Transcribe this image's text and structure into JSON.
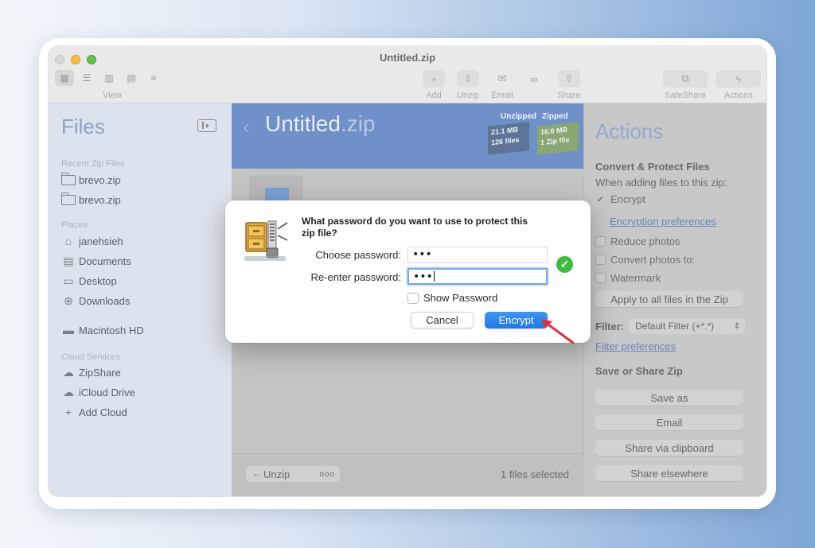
{
  "window": {
    "title": "Untitled.zip"
  },
  "toolbar": {
    "view_label": "View",
    "add_label": "Add",
    "unzip_label": "Unzip",
    "email_label": "Email",
    "link_label": "",
    "share_label": "Share",
    "safeshare_label": "SafeShare",
    "actions_label": "Actions"
  },
  "sidebar": {
    "title": "Files",
    "recent_header": "Recent Zip Files",
    "recent": [
      "brevo.zip",
      "brevo.zip"
    ],
    "places_header": "Places",
    "places": [
      "janehsieh",
      "Documents",
      "Desktop",
      "Downloads"
    ],
    "drive": "Macintosh HD",
    "cloud_header": "Cloud Services",
    "cloud": [
      "ZipShare",
      "iCloud Drive",
      "Add Cloud"
    ]
  },
  "main": {
    "zip_name": "Untitled",
    "zip_ext": ".zip",
    "unzipped_header": "Unzipped",
    "zipped_header": "Zipped",
    "unzipped_size": "21.1 MB",
    "unzipped_files": "126 files",
    "zipped_size": "16.0 MB",
    "zipped_files": "1 Zip file",
    "unzip_button": "Unzip",
    "more_button": "ooo",
    "selection_status": "1 files selected"
  },
  "actions": {
    "title": "Actions",
    "convert_header": "Convert & Protect Files",
    "when_adding": "When adding files to this zip:",
    "encrypt": "Encrypt",
    "encryption_prefs": "Encryption preferences",
    "reduce_photos": "Reduce photos",
    "convert_photos": "Convert photos to:",
    "watermark": "Watermark",
    "apply_all": "Apply to all files in the Zip",
    "filter_label": "Filter:",
    "filter_value": "Default Filter (+*.*)",
    "filter_prefs": "Filter preferences",
    "save_share_header": "Save or Share Zip",
    "save_as": "Save as",
    "email": "Email",
    "share_clipboard": "Share via clipboard",
    "share_elsewhere": "Share elsewhere"
  },
  "dialog": {
    "question": "What password do you want to use to protect this zip file?",
    "choose_label": "Choose password:",
    "choose_value": "•••",
    "reenter_label": "Re-enter password:",
    "reenter_value": "•••",
    "show_password": "Show Password",
    "cancel": "Cancel",
    "encrypt": "Encrypt"
  },
  "colors": {
    "accent": "#1f78e6",
    "zip_header": "#7090c9",
    "success": "#3cbd3a",
    "annotation_arrow": "#e0323c"
  }
}
